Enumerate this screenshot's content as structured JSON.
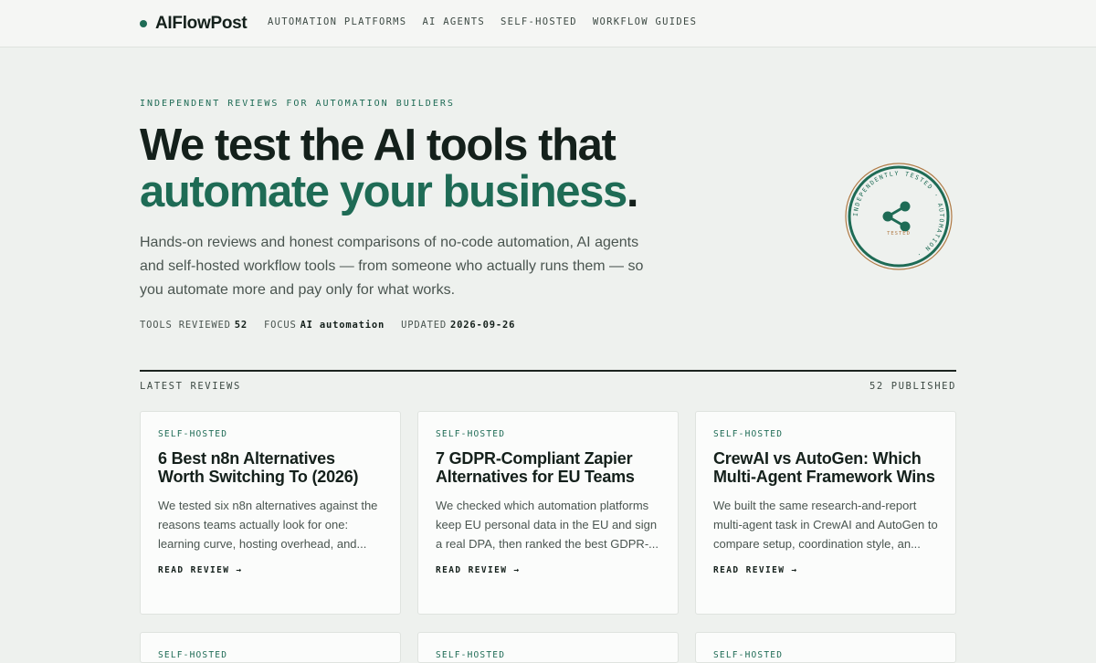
{
  "header": {
    "brand": "AIFlowPost",
    "nav": [
      "AUTOMATION PLATFORMS",
      "AI AGENTS",
      "SELF-HOSTED",
      "WORKFLOW GUIDES"
    ]
  },
  "hero": {
    "eyebrow": "INDEPENDENT REVIEWS FOR AUTOMATION BUILDERS",
    "title_line1": "We test the AI tools that",
    "title_line2": "automate your business",
    "title_period": ".",
    "description": "Hands-on reviews and honest comparisons of no-code automation, AI agents and self-hosted workflow tools — from someone who actually runs them — so you automate more and pay only for what works.",
    "meta": [
      {
        "label": "TOOLS REVIEWED",
        "value": "52"
      },
      {
        "label": "FOCUS",
        "value": "AI automation"
      },
      {
        "label": "UPDATED",
        "value": "2026-09-26"
      }
    ]
  },
  "stamp": {
    "ring_text": "INDEPENDENTLY TESTED · AUTOMATION ·",
    "center_text": "TESTED",
    "icon": "share-nodes-icon"
  },
  "section": {
    "label": "LATEST REVIEWS",
    "count": "52 PUBLISHED"
  },
  "cards": [
    {
      "tag": "SELF-HOSTED",
      "title": "6 Best n8n Alternatives Worth Switching To (2026)",
      "desc": "We tested six n8n alternatives against the reasons teams actually look for one: learning curve, hosting overhead, and...",
      "cta": "READ REVIEW →"
    },
    {
      "tag": "SELF-HOSTED",
      "title": "7 GDPR-Compliant Zapier Alternatives for EU Teams",
      "desc": "We checked which automation platforms keep EU personal data in the EU and sign a real DPA, then ranked the best GDPR-...",
      "cta": "READ REVIEW →"
    },
    {
      "tag": "SELF-HOSTED",
      "title": "CrewAI vs AutoGen: Which Multi-Agent Framework Wins",
      "desc": "We built the same research-and-report multi-agent task in CrewAI and AutoGen to compare setup, coordination style, an...",
      "cta": "READ REVIEW →"
    },
    {
      "tag": "SELF-HOSTED"
    },
    {
      "tag": "SELF-HOSTED"
    },
    {
      "tag": "SELF-HOSTED"
    }
  ],
  "colors": {
    "accent": "#1e6b55",
    "stamp_outer": "#b07a45",
    "background": "#eef1ee"
  }
}
